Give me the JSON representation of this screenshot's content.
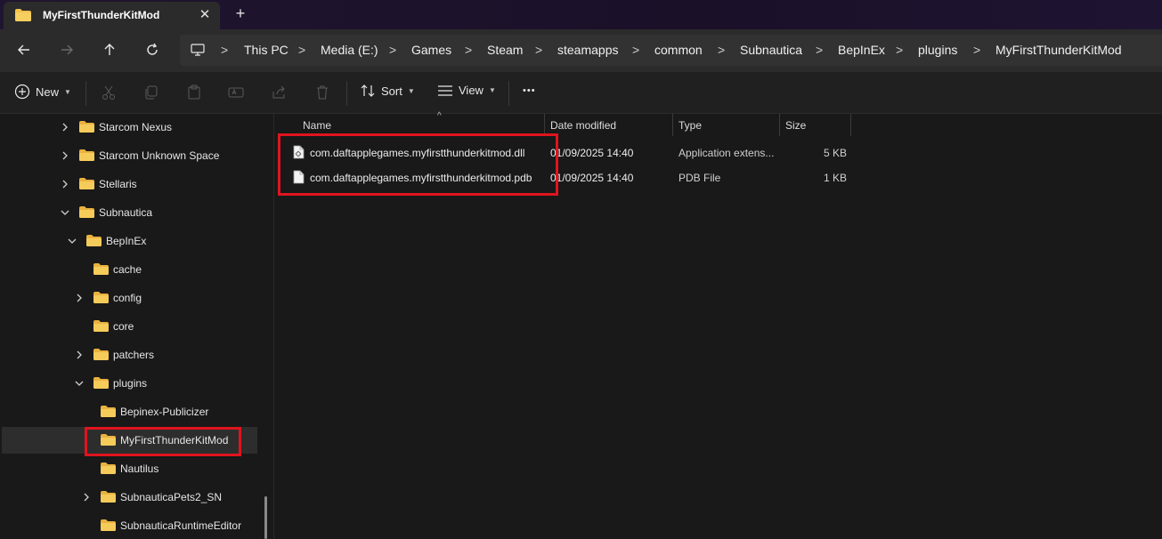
{
  "window": {
    "tab_title": "MyFirstThunderKitMod",
    "tab_close": "✕",
    "new_tab": "+"
  },
  "breadcrumbs": [
    "This PC",
    "Media (E:)",
    "Games",
    "Steam",
    "steamapps",
    "common",
    "Subnautica",
    "BepInEx",
    "plugins",
    "MyFirstThunderKitMod"
  ],
  "breadcrumb_separator": ">",
  "commands": {
    "new_label": "New",
    "sort_label": "Sort",
    "view_label": "View",
    "more_label": "•••"
  },
  "sidebar": {
    "items": [
      {
        "label": "Starcom Nexus"
      },
      {
        "label": "Starcom Unknown Space"
      },
      {
        "label": "Stellaris"
      },
      {
        "label": "Subnautica"
      },
      {
        "label": "BepInEx"
      },
      {
        "label": "cache"
      },
      {
        "label": "config"
      },
      {
        "label": "core"
      },
      {
        "label": "patchers"
      },
      {
        "label": "plugins"
      },
      {
        "label": "Bepinex-Publicizer"
      },
      {
        "label": "MyFirstThunderKitMod"
      },
      {
        "label": "Nautilus"
      },
      {
        "label": "SubnauticaPets2_SN"
      },
      {
        "label": "SubnauticaRuntimeEditor"
      }
    ]
  },
  "file_list": {
    "columns": [
      "Name",
      "Date modified",
      "Type",
      "Size"
    ],
    "rows": [
      {
        "name": "com.daftapplegames.myfirstthunderkitmod.dll",
        "date": "01/09/2025 14:40",
        "type": "Application extens...",
        "size": "5 KB"
      },
      {
        "name": "com.daftapplegames.myfirstthunderkitmod.pdb",
        "date": "01/09/2025 14:40",
        "type": "PDB File",
        "size": "1 KB"
      }
    ]
  },
  "colors": {
    "highlight": "#e0141e",
    "folder": "#f2c14e"
  }
}
